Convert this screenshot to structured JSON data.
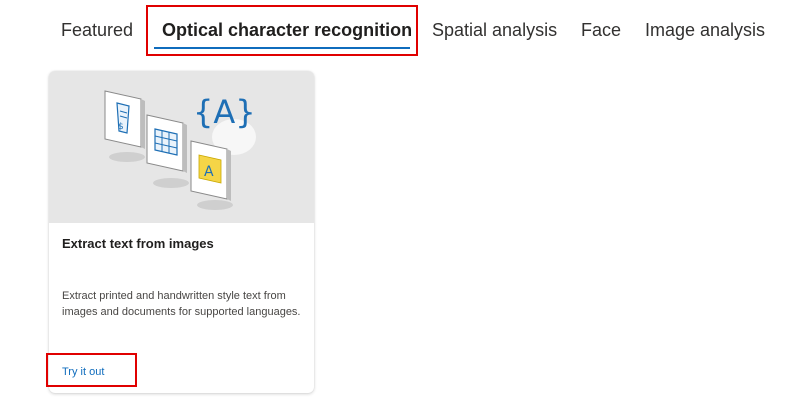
{
  "tabs": [
    {
      "label": "Featured",
      "active": false
    },
    {
      "label": "Optical character recognition",
      "active": true
    },
    {
      "label": "Spatial analysis",
      "active": false
    },
    {
      "label": "Face",
      "active": false
    },
    {
      "label": "Image analysis",
      "active": false
    }
  ],
  "card": {
    "illustration": {
      "icons": [
        "receipt-icon",
        "table-icon",
        "letter-a-sticky-note-icon",
        "curly-braces-a-icon"
      ],
      "glyph_text": "{A}",
      "note_letter": "A"
    },
    "title": "Extract text from images",
    "description": "Extract printed and handwritten style text from images and documents for supported languages.",
    "action_label": "Try it out"
  },
  "colors": {
    "accent": "#0f6cbd",
    "highlight": "#e00000",
    "hero_background": "#e6e6e6",
    "note_yellow": "#f5d547"
  }
}
